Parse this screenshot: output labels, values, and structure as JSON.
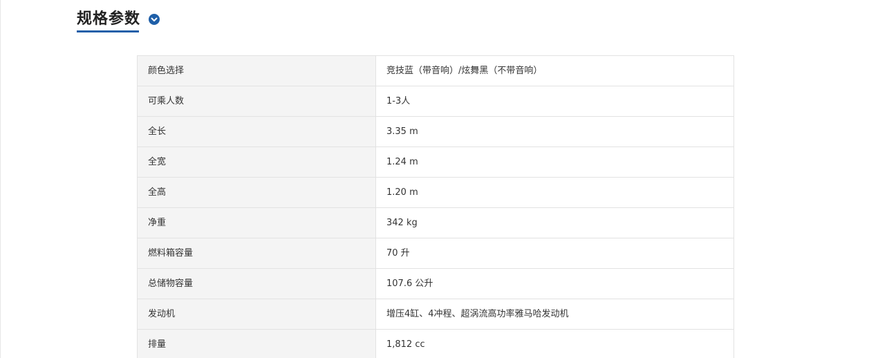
{
  "section": {
    "title": "规格参数",
    "accent_color": "#1f5fa8",
    "toggle_icon": "chevron-down-icon"
  },
  "specs": [
    {
      "label": "颜色选择",
      "value": "竞技蓝（带音响）/炫舞黑（不带音响）"
    },
    {
      "label": "可乘人数",
      "value": "1-3人"
    },
    {
      "label": "全长",
      "value": "3.35 m"
    },
    {
      "label": "全宽",
      "value": "1.24 m"
    },
    {
      "label": "全高",
      "value": "1.20 m"
    },
    {
      "label": "净重",
      "value": "342 kg"
    },
    {
      "label": "燃料箱容量",
      "value": "70 升"
    },
    {
      "label": "总储物容量",
      "value": "107.6 公升"
    },
    {
      "label": "发动机",
      "value": "增压4缸、4冲程、超涡流高功率雅马哈发动机"
    },
    {
      "label": "排量",
      "value": "1,812 cc"
    }
  ]
}
